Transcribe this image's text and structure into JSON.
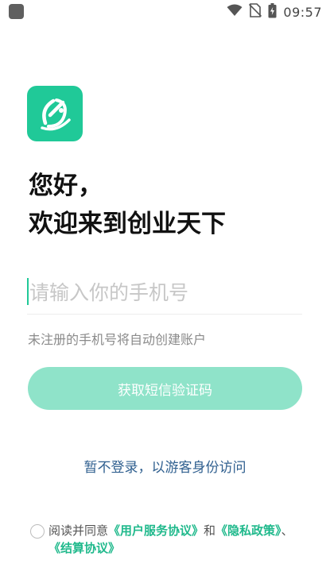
{
  "status_bar": {
    "time": "09:57",
    "icons": [
      "app-notification-icon",
      "wifi-icon",
      "no-sim-icon",
      "battery-charging-icon"
    ]
  },
  "logo": {
    "icon": "app-logo-icon",
    "background": "#20c998"
  },
  "greeting": {
    "line1": "您好，",
    "line2": "欢迎来到创业天下"
  },
  "phone": {
    "placeholder": "请输入你的手机号",
    "value": ""
  },
  "hint": "未注册的手机号将自动创建账户",
  "code_button": {
    "label": "获取短信验证码",
    "background": "#8fe3c9"
  },
  "guest_link": "暂不登录，以游客身份访问",
  "agreement": {
    "prefix": "阅读并同意",
    "user_agreement": "《用户服务协议》",
    "conj": "和",
    "privacy_policy": "《隐私政策》",
    "sep": "、",
    "settlement_agreement": "《结算协议》",
    "link_color": "#20b98c"
  }
}
